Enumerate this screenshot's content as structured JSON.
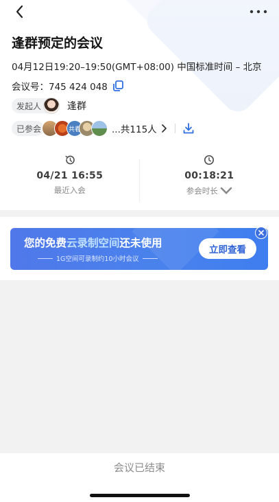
{
  "meeting": {
    "title": "逢群预定的会议",
    "time": "04月12日19:20–19:50(GMT+08:00) 中国标准时间 – 北京",
    "id_label": "会议号：",
    "id_value": "745 424 048"
  },
  "host": {
    "tag": "发起人",
    "name": "逢群"
  },
  "attendees": {
    "tag": "已参会",
    "avatar3_text": "共春",
    "count_text": "...共115人"
  },
  "stats": {
    "recent": {
      "value": "04/21 16:55",
      "label": "最近入会"
    },
    "duration": {
      "value": "00:18:21",
      "label": "参会时长"
    }
  },
  "banner": {
    "title_part1": "您的免费",
    "title_highlight": "云录制空间",
    "title_part2": "还未使用",
    "subtitle": "1G空间可录制约10小时会议",
    "button": "立即查看"
  },
  "footer": {
    "status": "会议已结束"
  },
  "icons": {
    "back": "chevron-left-icon",
    "more": "more-horizontal-icon",
    "copy": "copy-icon",
    "download": "download-icon",
    "history": "history-clock-icon",
    "clock": "clock-icon",
    "close": "close-icon"
  },
  "colors": {
    "accent": "#2f6fe0",
    "banner_start": "#5078ea",
    "banner_end": "#3f7ef0"
  }
}
